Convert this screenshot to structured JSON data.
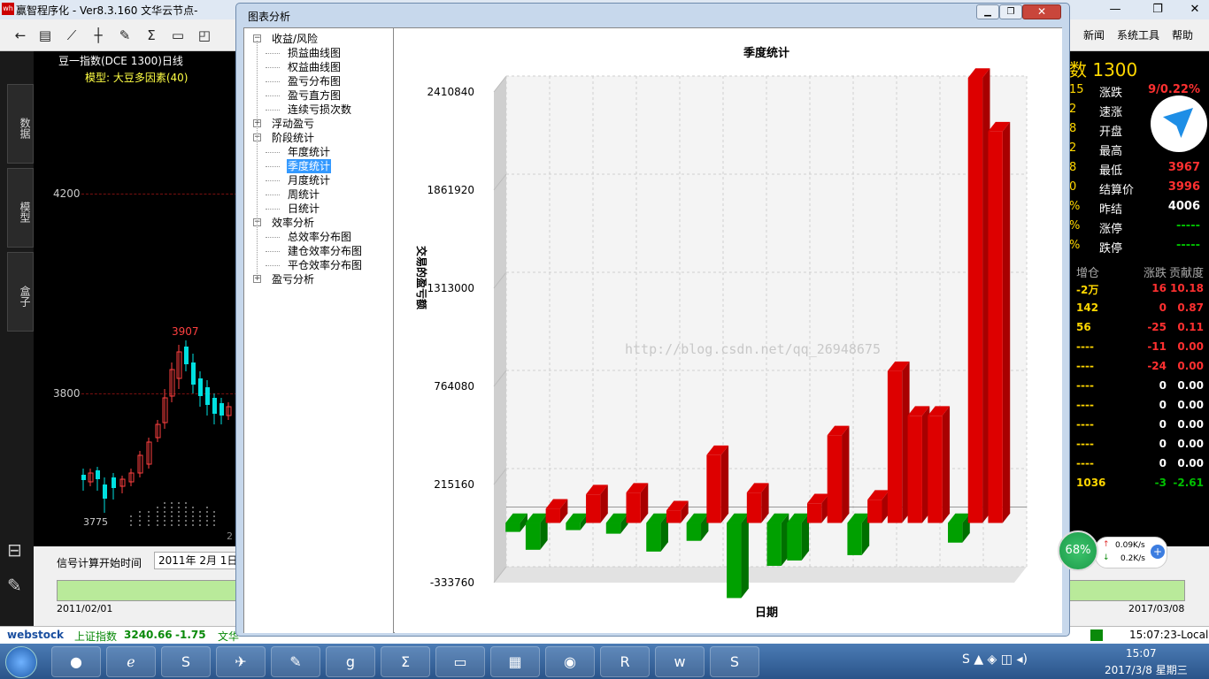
{
  "window": {
    "title": "赢智程序化  -  Ver8.3.160     文华云节点-",
    "buttons": [
      "—",
      "❐",
      "✕"
    ]
  },
  "menu": [
    "新闻",
    "系统工具",
    "帮助"
  ],
  "left_rail": [
    "数据",
    "模型",
    "盒子"
  ],
  "main_chart": {
    "heading": "豆一指数(DCE 1300)日线",
    "model": "模型: 大豆多因素(40)",
    "y_labels": [
      "4200",
      "3800"
    ],
    "high_label": "3907",
    "low_label": "3775",
    "extra": "2"
  },
  "quote": {
    "title": "数 1300",
    "rows": [
      {
        "left": "15",
        "label": "涨跌",
        "value": "9/0.22%",
        "color": "#ff3030"
      },
      {
        "left": "2",
        "label": "速涨",
        "value": "",
        "color": "#ff3030"
      },
      {
        "left": "8",
        "label": "开盘",
        "value": "",
        "color": "#ff3030"
      },
      {
        "left": "2",
        "label": "最高",
        "value": "",
        "color": "#ff3030"
      },
      {
        "left": "8",
        "label": "最低",
        "value": "3967",
        "color": "#ff3030"
      },
      {
        "left": "0",
        "label": "结算价",
        "value": "3996",
        "color": "#ff3030"
      },
      {
        "left": "%",
        "label": "昨结",
        "value": "4006",
        "color": "#ffffff"
      },
      {
        "left": "%",
        "label": "涨停",
        "value": "-----",
        "color": "#00c000"
      },
      {
        "left": "%",
        "label": "跌停",
        "value": "-----",
        "color": "#00c000"
      }
    ],
    "contrib_headers": [
      "增仓",
      "涨跌",
      "贡献度"
    ],
    "contrib_rows": [
      {
        "c1": "-2万",
        "c2": "16",
        "c3": "10.18",
        "col": "#ff3030"
      },
      {
        "c1": "142",
        "c2": "0",
        "c3": "0.87",
        "col": "#ff3030"
      },
      {
        "c1": "56",
        "c2": "-25",
        "c3": "0.11",
        "col": "#ff3030"
      },
      {
        "c1": "----",
        "c2": "-11",
        "c3": "0.00",
        "col": "#ff3030"
      },
      {
        "c1": "----",
        "c2": "-24",
        "c3": "0.00",
        "col": "#ff3030"
      },
      {
        "c1": "----",
        "c2": "0",
        "c3": "0.00",
        "col": "#ffffff"
      },
      {
        "c1": "----",
        "c2": "0",
        "c3": "0.00",
        "col": "#ffffff"
      },
      {
        "c1": "----",
        "c2": "0",
        "c3": "0.00",
        "col": "#ffffff"
      },
      {
        "c1": "----",
        "c2": "0",
        "c3": "0.00",
        "col": "#ffffff"
      },
      {
        "c1": "----",
        "c2": "0",
        "c3": "0.00",
        "col": "#ffffff"
      },
      {
        "c1": "1036",
        "c2": "-3",
        "c3": "-2.61",
        "col": "#00c000"
      }
    ]
  },
  "bottom": {
    "signal_label": "信号计算开始时间",
    "date_value": "2011年 2月 1日",
    "start_date": "2011/02/01",
    "end_date": "2017/03/08"
  },
  "stock_bar": {
    "brand": "webstock",
    "index_name": "上证指数",
    "index_value": "3240.66",
    "change": "-1.75",
    "trail": "文华",
    "clock": "15:07:23-Local"
  },
  "taskbar": {
    "time": "15:07",
    "date": "2017/3/8 星期三"
  },
  "net": {
    "gauge": "68%",
    "up": "0.09K/s",
    "down": "0.2K/s"
  },
  "dialog": {
    "title": "图表分析",
    "tree": [
      {
        "label": "收益/风险",
        "level": 0,
        "exp": "−"
      },
      {
        "label": "损益曲线图",
        "level": 1
      },
      {
        "label": "权益曲线图",
        "level": 1
      },
      {
        "label": "盈亏分布图",
        "level": 1
      },
      {
        "label": "盈亏直方图",
        "level": 1
      },
      {
        "label": "连续亏损次数",
        "level": 1
      },
      {
        "label": "浮动盈亏",
        "level": 0,
        "exp": "+"
      },
      {
        "label": "阶段统计",
        "level": 0,
        "exp": "−"
      },
      {
        "label": "年度统计",
        "level": 1
      },
      {
        "label": "季度统计",
        "level": 1,
        "selected": true
      },
      {
        "label": "月度统计",
        "level": 1
      },
      {
        "label": "周统计",
        "level": 1
      },
      {
        "label": "日统计",
        "level": 1
      },
      {
        "label": "效率分析",
        "level": 0,
        "exp": "−"
      },
      {
        "label": "总效率分布图",
        "level": 1
      },
      {
        "label": "建仓效率分布图",
        "level": 1
      },
      {
        "label": "平仓效率分布图",
        "level": 1
      },
      {
        "label": "盈亏分析",
        "level": 0,
        "exp": "+"
      }
    ]
  },
  "chart_data": {
    "type": "bar",
    "title": "季度统计",
    "xlabel": "日期",
    "ylabel": "交易的盈亏额",
    "watermark": "http://blog.csdn.net/qq_26948675",
    "y_ticks": [
      -333760,
      215160,
      764080,
      1313000,
      1861920,
      2410840
    ],
    "ylim": [
      -333760,
      2410840
    ],
    "colors": {
      "positive": "#dd0000",
      "negative": "#00a000"
    },
    "values": [
      -50000,
      -150000,
      80000,
      -40000,
      160000,
      -60000,
      170000,
      -160000,
      70000,
      -100000,
      380000,
      -420000,
      170000,
      -240000,
      -210000,
      110000,
      490000,
      -180000,
      130000,
      850000,
      600000,
      600000,
      -110000,
      2490000,
      2190000
    ]
  }
}
